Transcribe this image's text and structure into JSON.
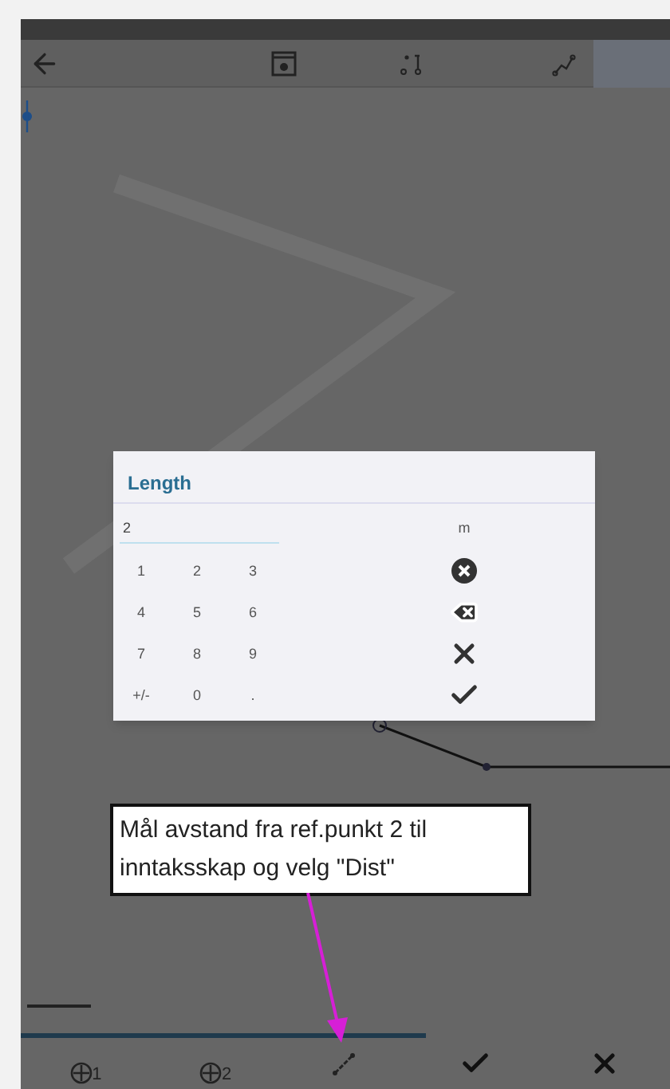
{
  "dialog": {
    "title": "Length",
    "value": "2",
    "unit": "m",
    "keys": [
      "1",
      "2",
      "3",
      "4",
      "5",
      "6",
      "7",
      "8",
      "9",
      "+/-",
      "0",
      "."
    ],
    "actions": [
      {
        "kind": "clear"
      },
      {
        "kind": "backspace"
      },
      {
        "kind": "cancel"
      },
      {
        "kind": "ok"
      }
    ]
  },
  "callout": {
    "text": "Mål avstand fra ref.punkt 2 til inntaksskap og velg \"Dist\""
  },
  "bottom_bar": {
    "items": [
      {
        "kind": "target",
        "index": "1"
      },
      {
        "kind": "target",
        "index": "2"
      },
      {
        "kind": "measure"
      },
      {
        "kind": "check"
      },
      {
        "kind": "close"
      }
    ]
  }
}
